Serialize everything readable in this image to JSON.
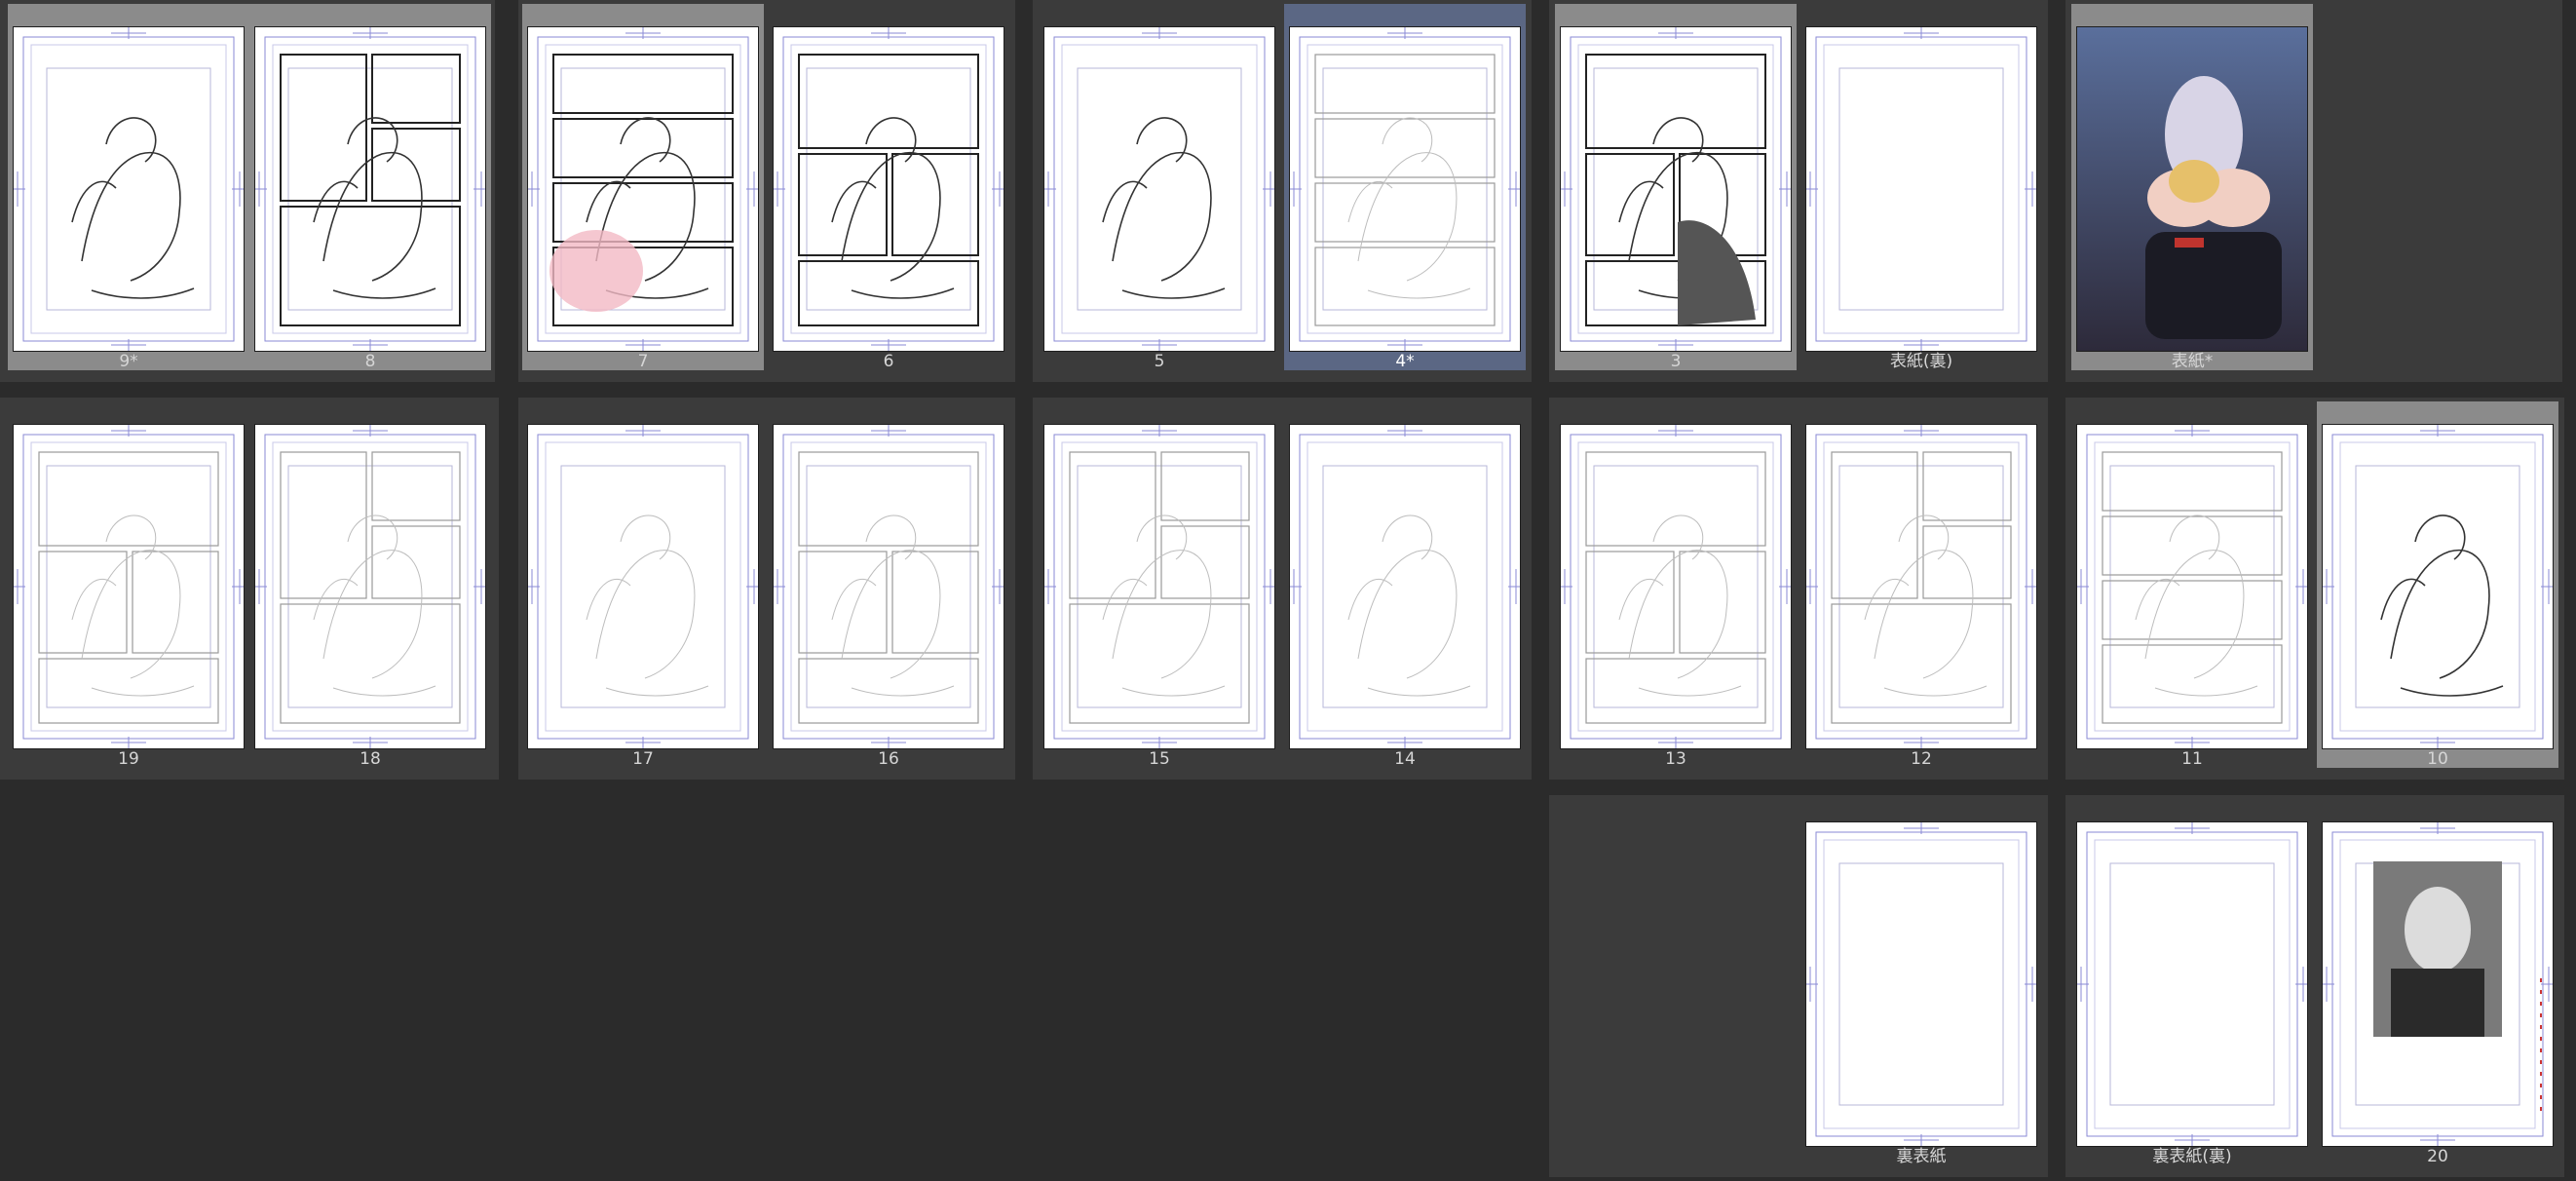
{
  "pages": {
    "p9": {
      "label": "9*"
    },
    "p8": {
      "label": "8"
    },
    "p7": {
      "label": "7"
    },
    "p6": {
      "label": "6"
    },
    "p5": {
      "label": "5"
    },
    "p4": {
      "label": "4*"
    },
    "p3": {
      "label": "3"
    },
    "cover_inner": {
      "label": "表紙(裏)"
    },
    "cover": {
      "label": "表紙*"
    },
    "p19": {
      "label": "19"
    },
    "p18": {
      "label": "18"
    },
    "p17": {
      "label": "17"
    },
    "p16": {
      "label": "16"
    },
    "p15": {
      "label": "15"
    },
    "p14": {
      "label": "14"
    },
    "p13": {
      "label": "13"
    },
    "p12": {
      "label": "12"
    },
    "p11": {
      "label": "11"
    },
    "p10": {
      "label": "10"
    },
    "back_cover": {
      "label": "裏表紙"
    },
    "back_cover_inner": {
      "label": "裏表紙(裏)"
    },
    "p20": {
      "label": "20"
    }
  },
  "colors": {
    "background": "#2b2b2b",
    "spread_panel": "#3b3b3b",
    "selected_gray": "#8b8b8b",
    "selected_blue": "#5b6784",
    "guide": "#8a8ad6",
    "page_label": "#d6d6d6"
  },
  "icons": {
    "page_thumbnail": "manga-page-thumbnail"
  }
}
